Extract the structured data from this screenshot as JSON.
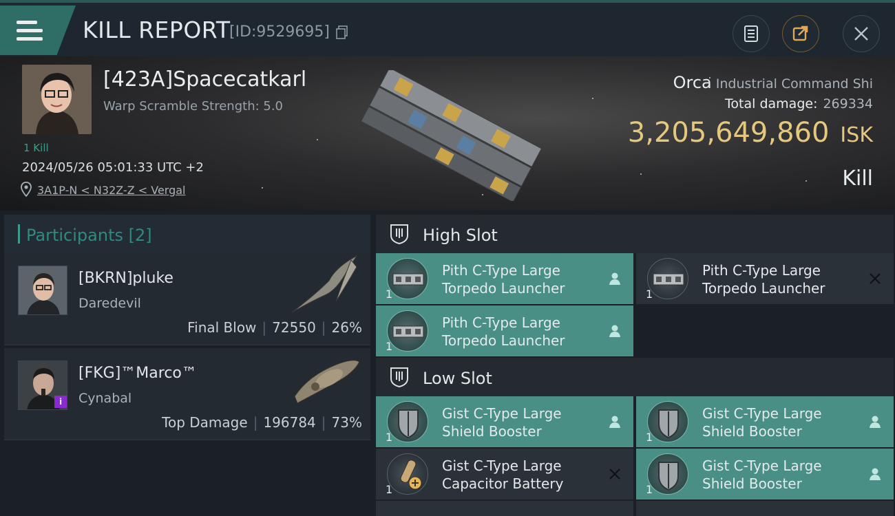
{
  "header": {
    "title": "KILL REPORT",
    "report_id": "[ID:9529695]"
  },
  "victim": {
    "name": "[423A]Spacecatkarl",
    "warp_scramble": "Warp Scramble Strength: 5.0",
    "kills": "1 Kill",
    "datetime": "2024/05/26 05:01:33 UTC +2",
    "location": "3A1P-N < N32Z-Z < Vergal",
    "ship_name": "Orca",
    "ship_class": "Industrial Command Shi",
    "total_damage_label": "Total damage:",
    "total_damage_value": "269334",
    "isk_value": "3,205,649,860",
    "isk_unit": "ISK",
    "result": "Kill"
  },
  "participants": {
    "title": "Participants",
    "count": "[2]",
    "rows": [
      {
        "name": "[BKRN]pluke",
        "ship": "Daredevil",
        "label": "Final Blow",
        "damage": "72550",
        "percent": "26%"
      },
      {
        "name": "[FKG]™Marco™",
        "ship": "Cynabal",
        "label": "Top Damage",
        "damage": "196784",
        "percent": "73%"
      }
    ]
  },
  "slots": {
    "high": {
      "title": "High Slot",
      "modules": [
        {
          "line1": "Pith C-Type Large",
          "line2": "Torpedo Launcher",
          "qty": "1",
          "status": "dropped"
        },
        {
          "line1": "Pith C-Type Large",
          "line2": "Torpedo Launcher",
          "qty": "1",
          "status": "destroyed"
        },
        {
          "line1": "Pith C-Type Large",
          "line2": "Torpedo Launcher",
          "qty": "1",
          "status": "dropped"
        }
      ]
    },
    "low": {
      "title": "Low Slot",
      "modules": [
        {
          "line1": "Gist C-Type Large",
          "line2": "Shield Booster",
          "qty": "1",
          "status": "dropped"
        },
        {
          "line1": "Gist C-Type Large",
          "line2": "Shield Booster",
          "qty": "1",
          "status": "dropped"
        },
        {
          "line1": "Gist C-Type Large",
          "line2": "Capacitor Battery",
          "qty": "1",
          "status": "destroyed"
        },
        {
          "line1": "Gist C-Type Large",
          "line2": "Shield Booster",
          "qty": "1",
          "status": "dropped"
        }
      ]
    }
  },
  "colors": {
    "accent_teal": "#4a8f86",
    "isk_gold": "#e6c87c",
    "header_bg": "#1e2730"
  }
}
